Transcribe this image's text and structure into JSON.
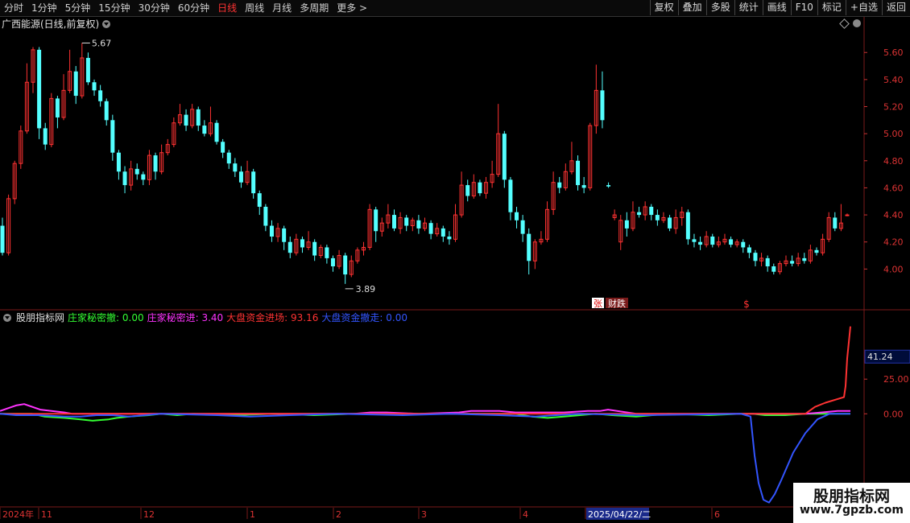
{
  "toolbar": {
    "periods": [
      "分时",
      "1分钟",
      "5分钟",
      "15分钟",
      "30分钟",
      "60分钟",
      "日线",
      "周线",
      "月线",
      "多周期",
      "更多 >"
    ],
    "active_index": 6,
    "right_buttons": [
      "复权",
      "叠加",
      "多股",
      "统计",
      "画线",
      "F10",
      "标记",
      "+自选",
      "返回"
    ]
  },
  "stock": {
    "title": "广西能源(日线,前复权)"
  },
  "indicator": {
    "name": "股朋指标网",
    "items": [
      {
        "label": "庄家秘密撤: 0.00",
        "color": "#33ff33"
      },
      {
        "label": "庄家秘密进: 3.40",
        "color": "#ff33ff"
      },
      {
        "label": "大盘资金进场: 93.16",
        "color": "#ff3333"
      },
      {
        "label": "大盘资金撤走: 0.00",
        "color": "#3355ff"
      }
    ]
  },
  "annotations": {
    "high_label": "5.67",
    "low_label": "3.89",
    "event_zhang": "张",
    "event_caijing": "财跌",
    "event_dollar": "$"
  },
  "date_axis": {
    "labels": [
      "2024年",
      "11",
      "12",
      "1",
      "2",
      "3",
      "4",
      "2025/04/22/二",
      "6"
    ]
  },
  "watermark": {
    "title": "股朋指标网",
    "url": "www.7gpzb.com"
  },
  "chart_data": [
    {
      "type": "candlestick",
      "title": "广西能源(日线,前复权)",
      "y_ticks": [
        5.6,
        5.4,
        5.2,
        5.0,
        4.8,
        4.6,
        4.4,
        4.2,
        4.0
      ],
      "ylim": [
        3.8,
        5.75
      ],
      "up_color": "#ff3232",
      "down_color": "#54ffff",
      "high_marker": 5.67,
      "low_marker": 3.89,
      "ohlc": [
        [
          4.32,
          4.12,
          4.38,
          4.1
        ],
        [
          4.12,
          4.52,
          4.55,
          4.1
        ],
        [
          4.52,
          4.78,
          4.8,
          4.48
        ],
        [
          4.78,
          5.02,
          5.06,
          4.74
        ],
        [
          5.02,
          5.38,
          5.52,
          5.0
        ],
        [
          5.38,
          5.62,
          5.64,
          5.3
        ],
        [
          5.62,
          5.04,
          5.64,
          4.96
        ],
        [
          5.04,
          4.92,
          5.08,
          4.88
        ],
        [
          4.92,
          5.26,
          5.3,
          4.9
        ],
        [
          5.26,
          5.12,
          5.28,
          5.04
        ],
        [
          5.12,
          5.32,
          5.44,
          5.1
        ],
        [
          5.32,
          5.46,
          5.62,
          5.3
        ],
        [
          5.46,
          5.28,
          5.5,
          5.22
        ],
        [
          5.28,
          5.56,
          5.67,
          5.26
        ],
        [
          5.56,
          5.38,
          5.6,
          5.36
        ],
        [
          5.38,
          5.32,
          5.4,
          5.28
        ],
        [
          5.32,
          5.24,
          5.36,
          5.2
        ],
        [
          5.24,
          5.1,
          5.26,
          5.06
        ],
        [
          5.1,
          4.86,
          5.14,
          4.8
        ],
        [
          4.86,
          4.72,
          4.88,
          4.66
        ],
        [
          4.72,
          4.62,
          4.76,
          4.56
        ],
        [
          4.62,
          4.74,
          4.8,
          4.58
        ],
        [
          4.74,
          4.7,
          4.78,
          4.66
        ],
        [
          4.7,
          4.66,
          4.72,
          4.62
        ],
        [
          4.66,
          4.84,
          4.88,
          4.62
        ],
        [
          4.84,
          4.72,
          4.86,
          4.66
        ],
        [
          4.72,
          4.86,
          4.92,
          4.7
        ],
        [
          4.86,
          4.92,
          4.96,
          4.84
        ],
        [
          4.92,
          5.08,
          5.12,
          4.9
        ],
        [
          5.08,
          5.14,
          5.22,
          5.06
        ],
        [
          5.14,
          5.06,
          5.18,
          5.02
        ],
        [
          5.06,
          5.18,
          5.22,
          5.04
        ],
        [
          5.18,
          5.06,
          5.2,
          5.02
        ],
        [
          5.06,
          5.0,
          5.1,
          4.98
        ],
        [
          5.0,
          5.08,
          5.2,
          4.98
        ],
        [
          5.08,
          4.94,
          5.1,
          4.92
        ],
        [
          4.94,
          4.86,
          4.96,
          4.82
        ],
        [
          4.86,
          4.78,
          4.88,
          4.74
        ],
        [
          4.78,
          4.72,
          4.82,
          4.68
        ],
        [
          4.72,
          4.64,
          4.76,
          4.6
        ],
        [
          4.64,
          4.72,
          4.8,
          4.62
        ],
        [
          4.72,
          4.56,
          4.74,
          4.52
        ],
        [
          4.56,
          4.46,
          4.58,
          4.4
        ],
        [
          4.46,
          4.32,
          4.48,
          4.28
        ],
        [
          4.32,
          4.24,
          4.36,
          4.2
        ],
        [
          4.24,
          4.3,
          4.34,
          4.2
        ],
        [
          4.3,
          4.2,
          4.32,
          4.14
        ],
        [
          4.2,
          4.12,
          4.24,
          4.08
        ],
        [
          4.12,
          4.22,
          4.26,
          4.1
        ],
        [
          4.22,
          4.16,
          4.24,
          4.12
        ],
        [
          4.16,
          4.2,
          4.28,
          4.14
        ],
        [
          4.2,
          4.1,
          4.22,
          4.06
        ],
        [
          4.1,
          4.16,
          4.18,
          4.08
        ],
        [
          4.16,
          4.08,
          4.18,
          4.04
        ],
        [
          4.08,
          4.02,
          4.1,
          3.98
        ],
        [
          4.02,
          4.1,
          4.14,
          4.0
        ],
        [
          4.1,
          3.96,
          4.12,
          3.89
        ],
        [
          3.96,
          4.06,
          4.1,
          3.94
        ],
        [
          4.06,
          4.14,
          4.16,
          4.04
        ],
        [
          4.14,
          4.16,
          4.2,
          4.1
        ],
        [
          4.16,
          4.44,
          4.48,
          4.14
        ],
        [
          4.44,
          4.28,
          4.46,
          4.2
        ],
        [
          4.28,
          4.34,
          4.38,
          4.24
        ],
        [
          4.34,
          4.4,
          4.48,
          4.3
        ],
        [
          4.4,
          4.3,
          4.44,
          4.28
        ],
        [
          4.3,
          4.38,
          4.42,
          4.26
        ],
        [
          4.38,
          4.32,
          4.4,
          4.28
        ],
        [
          4.32,
          4.36,
          4.38,
          4.28
        ],
        [
          4.36,
          4.3,
          4.4,
          4.26
        ],
        [
          4.3,
          4.34,
          4.38,
          4.28
        ],
        [
          4.34,
          4.26,
          4.36,
          4.22
        ],
        [
          4.26,
          4.3,
          4.34,
          4.24
        ],
        [
          4.3,
          4.24,
          4.32,
          4.2
        ],
        [
          4.24,
          4.22,
          4.28,
          4.18
        ],
        [
          4.22,
          4.4,
          4.48,
          4.2
        ],
        [
          4.4,
          4.62,
          4.72,
          4.38
        ],
        [
          4.62,
          4.54,
          4.66,
          4.5
        ],
        [
          4.54,
          4.64,
          4.7,
          4.52
        ],
        [
          4.64,
          4.56,
          4.66,
          4.54
        ],
        [
          4.56,
          4.64,
          4.68,
          4.52
        ],
        [
          4.64,
          4.7,
          4.8,
          4.6
        ],
        [
          4.7,
          5.0,
          5.22,
          4.68
        ],
        [
          5.0,
          4.66,
          5.02,
          4.6
        ],
        [
          4.66,
          4.42,
          4.68,
          4.36
        ],
        [
          4.42,
          4.36,
          4.46,
          4.3
        ],
        [
          4.36,
          4.26,
          4.4,
          4.2
        ],
        [
          4.26,
          4.06,
          4.3,
          3.96
        ],
        [
          4.06,
          4.2,
          4.22,
          4.0
        ],
        [
          4.2,
          4.22,
          4.28,
          4.18
        ],
        [
          4.22,
          4.44,
          4.5,
          4.2
        ],
        [
          4.44,
          4.64,
          4.72,
          4.4
        ],
        [
          4.64,
          4.6,
          4.68,
          4.56
        ],
        [
          4.6,
          4.72,
          4.78,
          4.58
        ],
        [
          4.72,
          4.8,
          4.94,
          4.7
        ],
        [
          4.8,
          4.62,
          4.84,
          4.58
        ],
        [
          4.62,
          4.6,
          4.68,
          4.56
        ],
        [
          4.6,
          5.06,
          5.08,
          4.58
        ],
        [
          5.06,
          5.32,
          5.51,
          5.0
        ],
        [
          5.32,
          5.1,
          5.46,
          5.04
        ],
        [
          4.62,
          4.61,
          4.64,
          4.6
        ],
        [
          4.38,
          4.4,
          4.44,
          4.36
        ],
        [
          4.2,
          4.36,
          4.4,
          4.14
        ],
        [
          4.36,
          4.3,
          4.42,
          4.24
        ],
        [
          4.3,
          4.42,
          4.5,
          4.28
        ],
        [
          4.42,
          4.4,
          4.46,
          4.38
        ],
        [
          4.4,
          4.46,
          4.5,
          4.36
        ],
        [
          4.46,
          4.4,
          4.48,
          4.36
        ],
        [
          4.4,
          4.36,
          4.44,
          4.32
        ],
        [
          4.36,
          4.38,
          4.42,
          4.34
        ],
        [
          4.38,
          4.3,
          4.4,
          4.28
        ],
        [
          4.3,
          4.38,
          4.44,
          4.26
        ],
        [
          4.38,
          4.42,
          4.46,
          4.32
        ],
        [
          4.42,
          4.22,
          4.44,
          4.18
        ],
        [
          4.22,
          4.2,
          4.26,
          4.16
        ],
        [
          4.2,
          4.18,
          4.24,
          4.14
        ],
        [
          4.18,
          4.24,
          4.28,
          4.16
        ],
        [
          4.24,
          4.18,
          4.26,
          4.16
        ],
        [
          4.18,
          4.2,
          4.24,
          4.16
        ],
        [
          4.2,
          4.22,
          4.26,
          4.18
        ],
        [
          4.22,
          4.18,
          4.24,
          4.16
        ],
        [
          4.18,
          4.2,
          4.22,
          4.16
        ],
        [
          4.2,
          4.16,
          4.22,
          4.12
        ],
        [
          4.16,
          4.12,
          4.18,
          4.08
        ],
        [
          4.12,
          4.06,
          4.14,
          4.02
        ],
        [
          4.06,
          4.08,
          4.12,
          4.02
        ],
        [
          4.08,
          4.02,
          4.1,
          3.98
        ],
        [
          4.02,
          3.98,
          4.04,
          3.96
        ],
        [
          3.98,
          4.04,
          4.06,
          3.96
        ],
        [
          4.04,
          4.06,
          4.1,
          4.02
        ],
        [
          4.06,
          4.04,
          4.1,
          4.02
        ],
        [
          4.04,
          4.08,
          4.12,
          4.02
        ],
        [
          4.08,
          4.06,
          4.12,
          4.04
        ],
        [
          4.06,
          4.14,
          4.18,
          4.04
        ],
        [
          4.14,
          4.12,
          4.16,
          4.1
        ],
        [
          4.12,
          4.22,
          4.26,
          4.1
        ],
        [
          4.22,
          4.38,
          4.42,
          4.2
        ],
        [
          4.38,
          4.3,
          4.42,
          4.28
        ],
        [
          4.3,
          4.34,
          4.48,
          4.28
        ],
        [
          4.4,
          4.4,
          4.41,
          4.39
        ]
      ]
    },
    {
      "type": "line",
      "y_ticks": [
        41.24,
        25.0,
        0.0
      ],
      "ylim": [
        -66,
        64
      ],
      "series": [
        {
          "name": "庄家秘密撤",
          "color": "#33ff33",
          "x": [
            0,
            40,
            55,
            80,
            100,
            115,
            135,
            145,
            160,
            185,
            200,
            220,
            240,
            290,
            340,
            390,
            440,
            520,
            580,
            640,
            660,
            680,
            700,
            740,
            760,
            790,
            830,
            880,
            920,
            935,
            950,
            975,
            1000,
            1056
          ],
          "y": [
            0,
            0,
            -2,
            -3,
            -4,
            -5,
            -4,
            -3,
            -2,
            -1,
            0,
            -1,
            0,
            -1,
            0,
            -1,
            0,
            0,
            0,
            0,
            -2,
            -3,
            -2,
            0,
            -1,
            -2,
            0,
            -1,
            0,
            0,
            -1,
            -1,
            0,
            0
          ]
        },
        {
          "name": "庄家秘密进",
          "color": "#ff33ff",
          "x": [
            0,
            20,
            30,
            50,
            80,
            90,
            110,
            200,
            440,
            460,
            480,
            520,
            570,
            585,
            620,
            640,
            700,
            730,
            745,
            755,
            790,
            1000,
            1020,
            1040,
            1056
          ],
          "y": [
            2,
            6,
            7,
            3,
            1,
            0,
            0,
            0,
            0,
            1,
            1,
            0,
            1,
            2,
            2,
            1,
            1,
            2,
            2,
            3,
            0,
            0,
            1,
            2,
            2
          ]
        },
        {
          "name": "大盘资金进场",
          "color": "#ff3333",
          "x": [
            0,
            1000,
            1012,
            1025,
            1048,
            1050,
            1052,
            1056
          ],
          "y": [
            0,
            0,
            5,
            8,
            12,
            20,
            40,
            63
          ]
        },
        {
          "name": "大盘资金撤走",
          "color": "#3355ff",
          "x": [
            0,
            20,
            50,
            80,
            100,
            120,
            140,
            160,
            180,
            200,
            270,
            310,
            360,
            420,
            500,
            560,
            620,
            665,
            690,
            720,
            800,
            920,
            932,
            937,
            942,
            948,
            955,
            962,
            970,
            985,
            1000,
            1015,
            1030,
            1056
          ],
          "y": [
            0,
            -1,
            -1,
            -2,
            -2,
            -1,
            -1,
            -2,
            -1,
            0,
            -1,
            -2,
            -1,
            0,
            -1,
            0,
            -1,
            -2,
            -1,
            0,
            -1,
            0,
            -2,
            -30,
            -50,
            -62,
            -64,
            -58,
            -48,
            -28,
            -14,
            -4,
            0,
            0
          ]
        }
      ]
    }
  ]
}
